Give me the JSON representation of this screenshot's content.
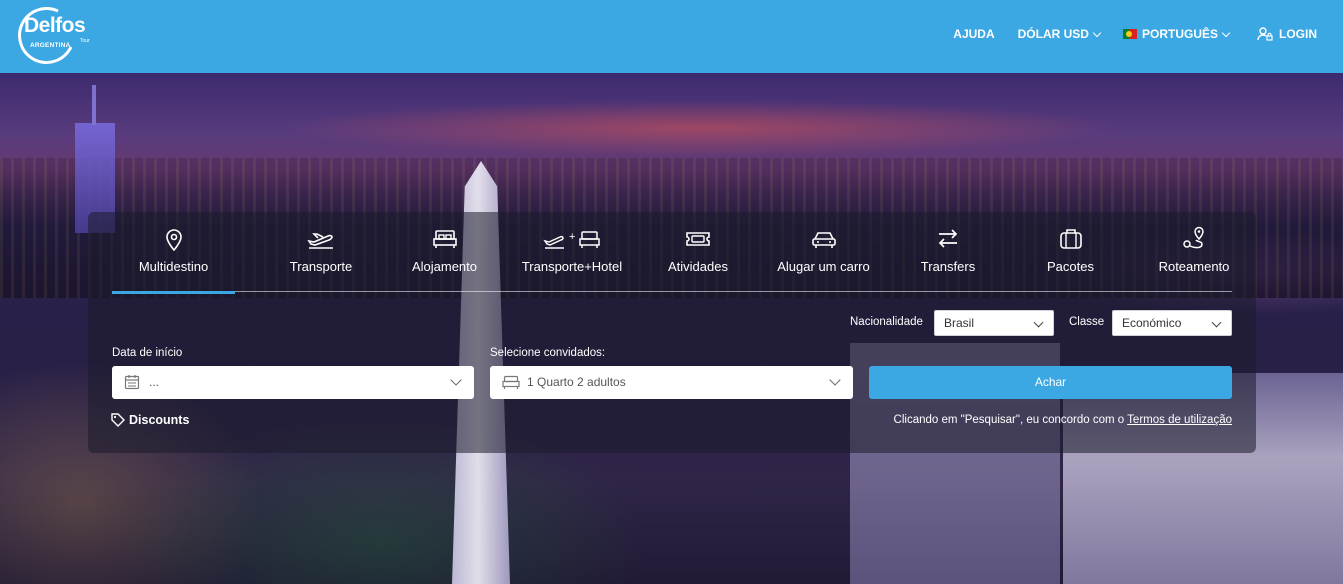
{
  "header": {
    "logo": {
      "word": "Delfos",
      "sub": "ARGENTINA",
      "tour": "Tour"
    },
    "nav": {
      "help": "AJUDA",
      "currency": "DÓLAR USD",
      "language": "PORTUGUÊS",
      "login": "LOGIN"
    },
    "colors": {
      "bar": "#3ba7e3"
    }
  },
  "search": {
    "tabs": [
      {
        "label": "Multidestino",
        "icon": "map-pin-icon",
        "active": true
      },
      {
        "label": "Transporte",
        "icon": "plane-icon"
      },
      {
        "label": "Alojamento",
        "icon": "bed-icon"
      },
      {
        "label": "Transporte+Hotel",
        "icon": "plane-plus-bed-icon"
      },
      {
        "label": "Atividades",
        "icon": "ticket-icon"
      },
      {
        "label": "Alugar um carro",
        "icon": "car-icon"
      },
      {
        "label": "Transfers",
        "icon": "arrows-exchange-icon"
      },
      {
        "label": "Pacotes",
        "icon": "suitcase-icon"
      },
      {
        "label": "Roteamento",
        "icon": "route-icon"
      }
    ],
    "nationality": {
      "label": "Nacionalidade",
      "value": "Brasil"
    },
    "class": {
      "label": "Classe",
      "value": "Económico"
    },
    "start_date": {
      "label": "Data de início",
      "value": "..."
    },
    "guests": {
      "label": "Selecione convidados:",
      "value": "1 Quarto 2 adultos"
    },
    "submit_label": "Achar",
    "discounts_label": "Discounts",
    "terms_text": "Clicando em \"Pesquisar\", eu concordo com o",
    "terms_link": "Termos de utilização"
  }
}
